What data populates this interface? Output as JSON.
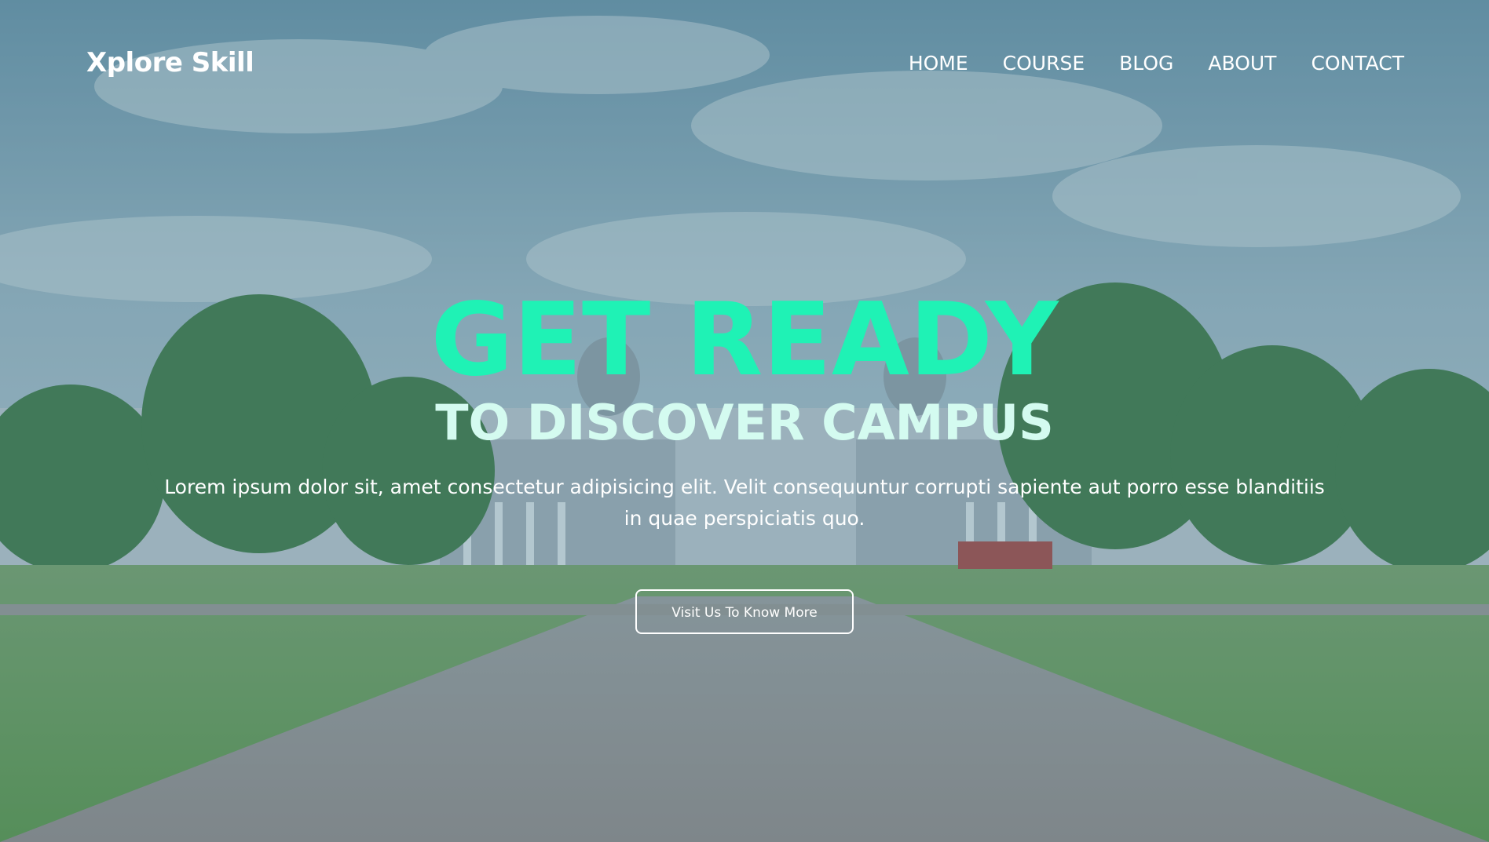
{
  "brand": {
    "logo_text": "Xplore Skill"
  },
  "nav": {
    "items": [
      {
        "label": "HOME"
      },
      {
        "label": "COURSE"
      },
      {
        "label": "BLOG"
      },
      {
        "label": "ABOUT"
      },
      {
        "label": "CONTACT"
      }
    ]
  },
  "hero": {
    "headline": "GET READY",
    "subheadline": "TO DISCOVER CAMPUS",
    "description": "Lorem ipsum dolor sit, amet consectetur adipisicing elit. Velit consequuntur corrupti sapiente aut porro esse blanditiis in quae perspiciatis quo.",
    "cta_label": "Visit Us To Know More"
  },
  "colors": {
    "accent": "#1ff2b5",
    "subheadline": "#d4fbf0",
    "text": "#ffffff"
  }
}
